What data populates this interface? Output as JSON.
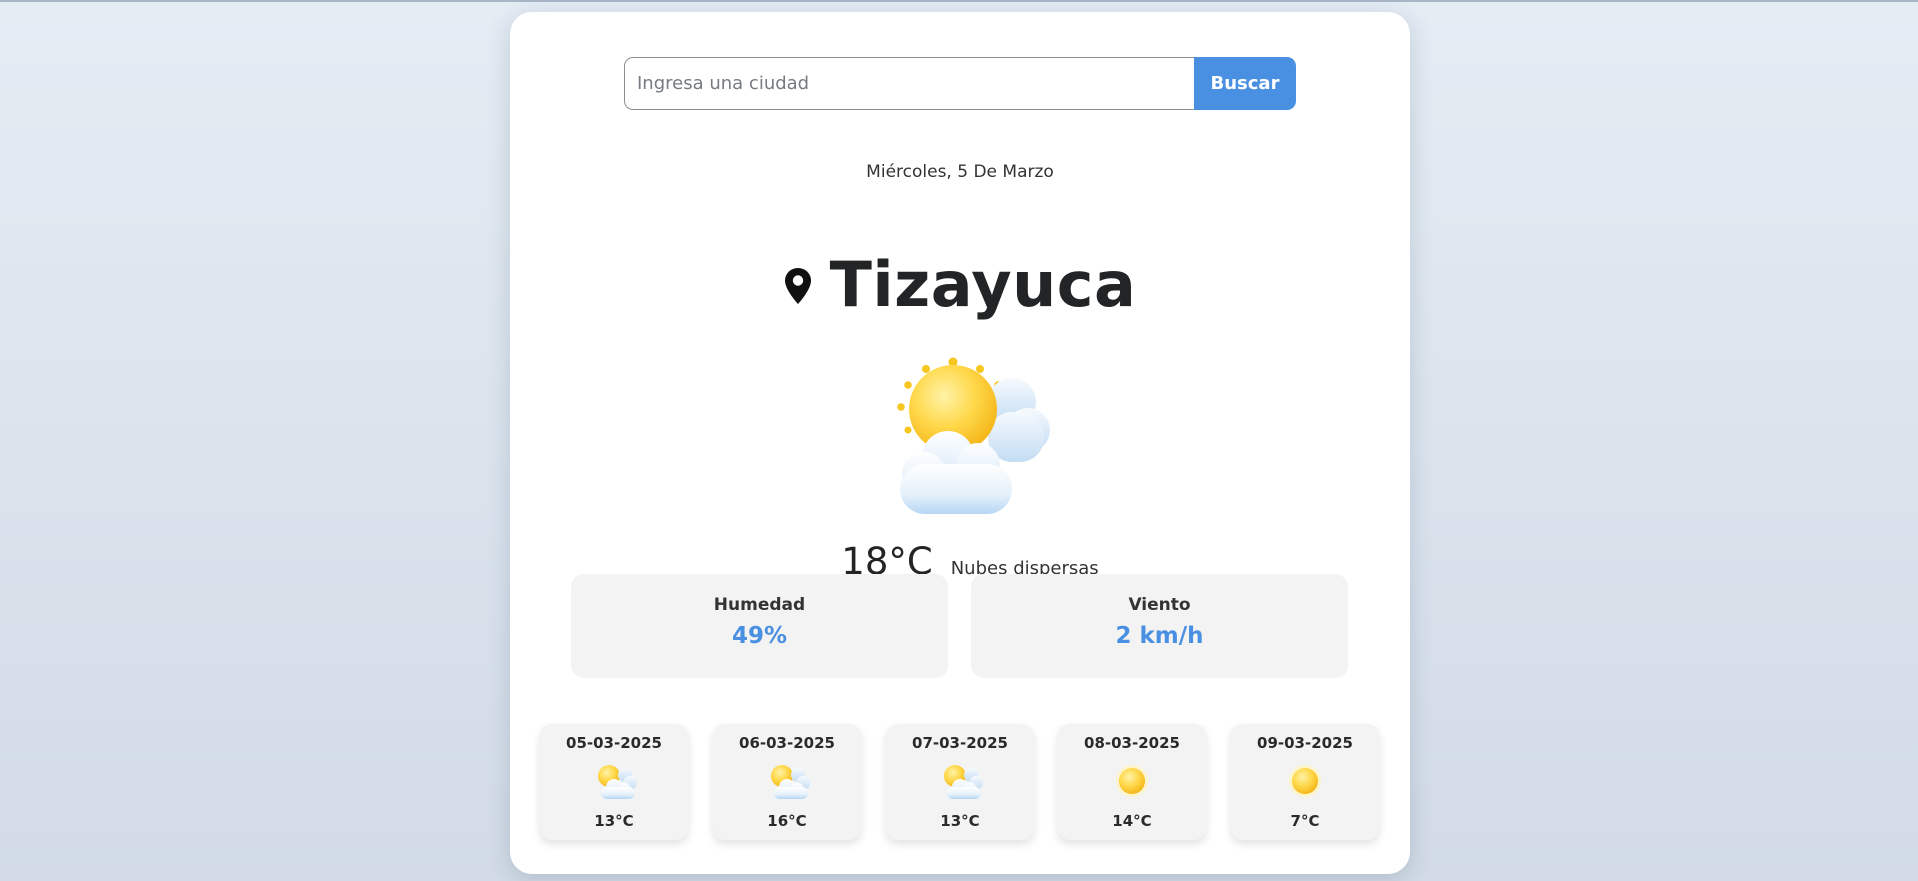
{
  "search": {
    "placeholder": "Ingresa una ciudad",
    "value": "",
    "button_label": "Buscar"
  },
  "date": "Miércoles, 5 De Marzo",
  "location": {
    "icon": "location-pin-icon",
    "city": "Tizayuca"
  },
  "current": {
    "icon": "sun-behind-clouds-icon",
    "temperature": "18°C",
    "description": "Nubes dispersas"
  },
  "stats": {
    "humidity_label": "Humedad",
    "humidity_value": "49%",
    "wind_label": "Viento",
    "wind_value": "2 km/h"
  },
  "forecast": [
    {
      "date": "05-03-2025",
      "icon": "sun-behind-clouds-icon",
      "temp": "13°C"
    },
    {
      "date": "06-03-2025",
      "icon": "sun-behind-clouds-icon",
      "temp": "16°C"
    },
    {
      "date": "07-03-2025",
      "icon": "sun-behind-clouds-icon",
      "temp": "13°C"
    },
    {
      "date": "08-03-2025",
      "icon": "sun-icon",
      "temp": "14°C"
    },
    {
      "date": "09-03-2025",
      "icon": "sun-icon",
      "temp": "7°C"
    }
  ],
  "colors": {
    "accent": "#4a90e2",
    "card_background": "#ffffff",
    "panel_background": "#f3f3f3"
  }
}
